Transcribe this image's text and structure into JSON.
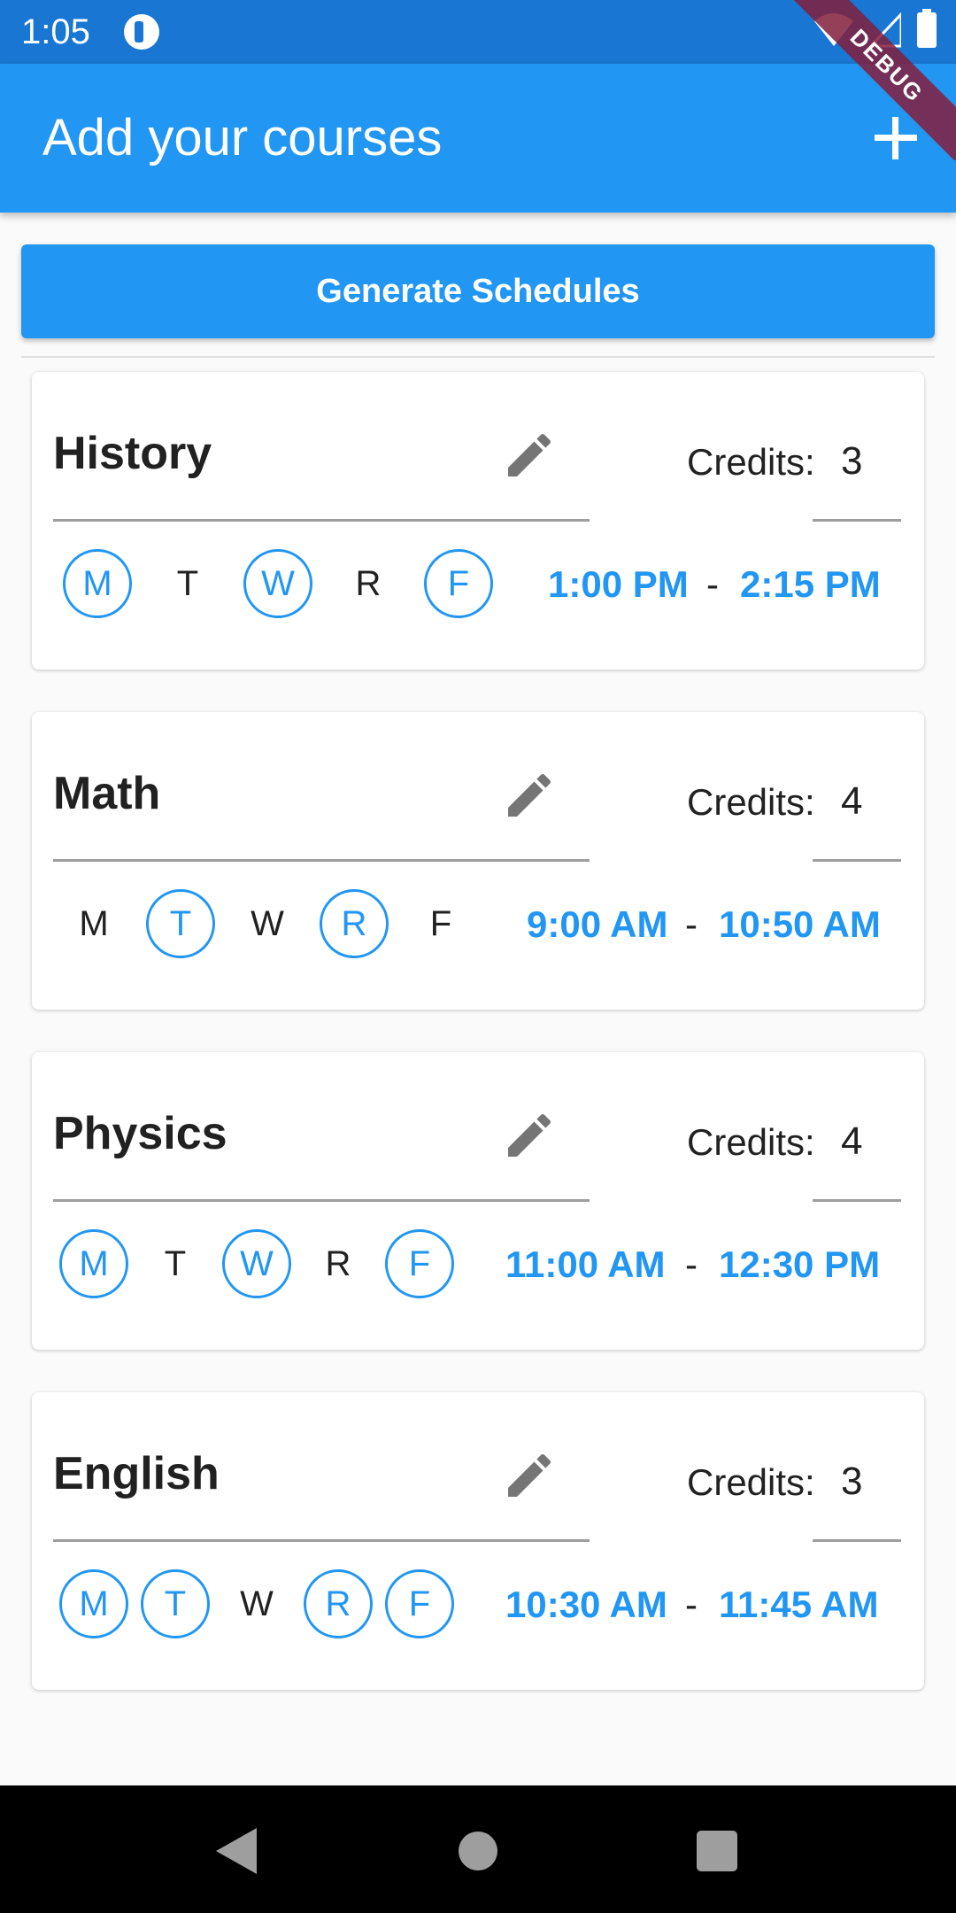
{
  "status_bar": {
    "time": "1:05"
  },
  "debug_banner": "DEBUG",
  "app_bar": {
    "title": "Add your courses",
    "add_icon": "plus-icon"
  },
  "generate_button": "Generate Schedules",
  "courses": [
    {
      "name": "History",
      "credits_label": "Credits:",
      "credits": "3",
      "days": [
        {
          "label": "M",
          "selected": true
        },
        {
          "label": "T",
          "selected": false
        },
        {
          "label": "W",
          "selected": true
        },
        {
          "label": "R",
          "selected": false
        },
        {
          "label": "F",
          "selected": true
        }
      ],
      "start_time": "1:00 PM",
      "separator": "-",
      "end_time": "2:15 PM"
    },
    {
      "name": "Math",
      "credits_label": "Credits:",
      "credits": "4",
      "days": [
        {
          "label": "M",
          "selected": false
        },
        {
          "label": "T",
          "selected": true
        },
        {
          "label": "W",
          "selected": false
        },
        {
          "label": "R",
          "selected": true
        },
        {
          "label": "F",
          "selected": false
        }
      ],
      "start_time": "9:00 AM",
      "separator": "-",
      "end_time": "10:50 AM"
    },
    {
      "name": "Physics",
      "credits_label": "Credits:",
      "credits": "4",
      "days": [
        {
          "label": "M",
          "selected": true
        },
        {
          "label": "T",
          "selected": false
        },
        {
          "label": "W",
          "selected": true
        },
        {
          "label": "R",
          "selected": false
        },
        {
          "label": "F",
          "selected": true
        }
      ],
      "start_time": "11:00 AM",
      "separator": "-",
      "end_time": "12:30 PM"
    },
    {
      "name": "English",
      "credits_label": "Credits:",
      "credits": "3",
      "days": [
        {
          "label": "M",
          "selected": true
        },
        {
          "label": "T",
          "selected": true
        },
        {
          "label": "W",
          "selected": false
        },
        {
          "label": "R",
          "selected": true
        },
        {
          "label": "F",
          "selected": true
        }
      ],
      "start_time": "10:30 AM",
      "separator": "-",
      "end_time": "11:45 AM"
    }
  ],
  "colors": {
    "primary": "#2196f3",
    "status_bar": "#1976d2"
  }
}
